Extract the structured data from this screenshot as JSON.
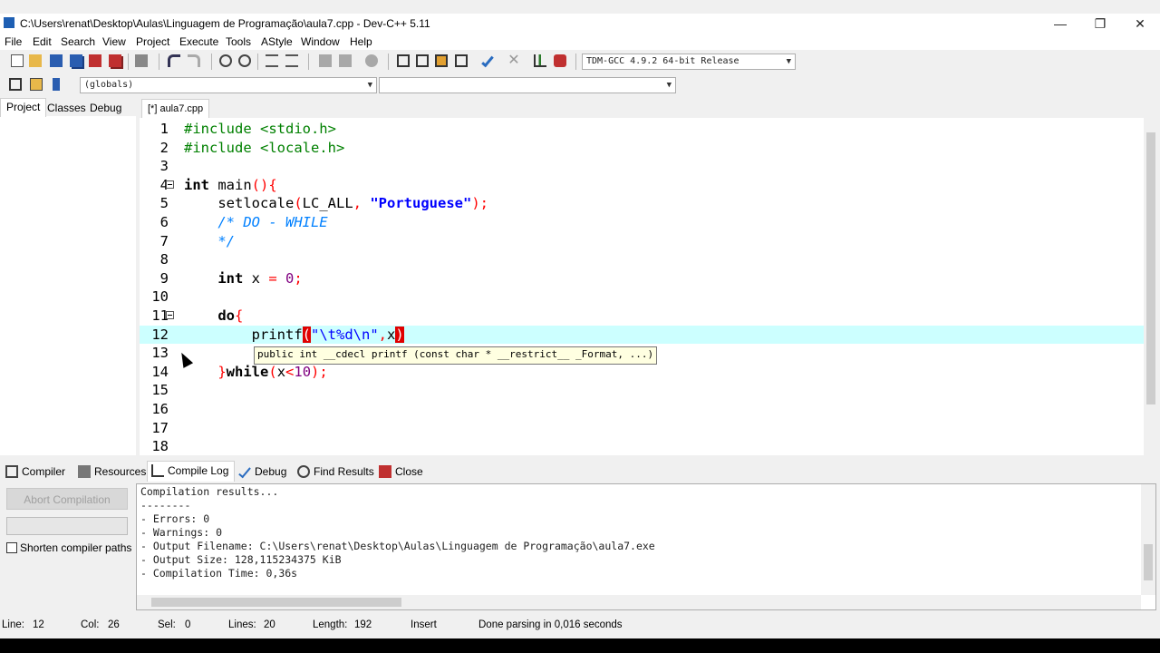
{
  "window": {
    "title": "C:\\Users\\renat\\Desktop\\Aulas\\Linguagem de Programação\\aula7.cpp - Dev-C++ 5.11",
    "minimize": "—",
    "restore": "❐",
    "close": "✕"
  },
  "menu": [
    "File",
    "Edit",
    "Search",
    "View",
    "Project",
    "Execute",
    "Tools",
    "AStyle",
    "Window",
    "Help"
  ],
  "toolbar": {
    "compiler_select": "TDM-GCC 4.9.2 64-bit Release",
    "scope_select": "(globals)",
    "member_select": ""
  },
  "left_panel": {
    "tabs": [
      "Project",
      "Classes",
      "Debug"
    ]
  },
  "editor": {
    "tab_label": "[*] aula7.cpp",
    "lines": [
      {
        "n": "1"
      },
      {
        "n": "2"
      },
      {
        "n": "3"
      },
      {
        "n": "4"
      },
      {
        "n": "5"
      },
      {
        "n": "6"
      },
      {
        "n": "7"
      },
      {
        "n": "8"
      },
      {
        "n": "9"
      },
      {
        "n": "10"
      },
      {
        "n": "11"
      },
      {
        "n": "12"
      },
      {
        "n": "13"
      },
      {
        "n": "14"
      },
      {
        "n": "15"
      },
      {
        "n": "16"
      },
      {
        "n": "17"
      },
      {
        "n": "18"
      }
    ],
    "code": {
      "l1": "#include <stdio.h>",
      "l2": "#include <locale.h>",
      "l4_kw": "int",
      "l4_rest": " main",
      "l5_fn": "setlocale",
      "l5_arg": "LC_ALL",
      "l5_str": "\"Portuguese\"",
      "l6": "/* DO - WHILE",
      "l7": "*/",
      "l9_kw": "int",
      "l9_var": " x ",
      "l9_num": "0",
      "l11_kw": "do",
      "l12_fn": "printf",
      "l12_str": "\"\\t%d\\n\"",
      "l12_var": "x",
      "l14_kw": "while",
      "l14_var": "x",
      "l14_num": "10"
    },
    "tooltip": "public int __cdecl printf (const char * __restrict__ _Format, ...)"
  },
  "bottom_tabs": [
    "Compiler",
    "Resources",
    "Compile Log",
    "Debug",
    "Find Results",
    "Close"
  ],
  "compile_panel": {
    "abort_label": "Abort Compilation",
    "shorten_label": "Shorten compiler paths",
    "log": [
      "Compilation results...",
      "--------",
      "- Errors: 0",
      "- Warnings: 0",
      "- Output Filename: C:\\Users\\renat\\Desktop\\Aulas\\Linguagem de Programação\\aula7.exe",
      "- Output Size: 128,115234375 KiB",
      "- Compilation Time: 0,36s"
    ]
  },
  "status": {
    "line_label": "Line:",
    "line": "12",
    "col_label": "Col:",
    "col": "26",
    "sel_label": "Sel:",
    "sel": "0",
    "lines_label": "Lines:",
    "lines": "20",
    "length_label": "Length:",
    "length": "192",
    "mode": "Insert",
    "message": "Done parsing in 0,016 seconds"
  }
}
